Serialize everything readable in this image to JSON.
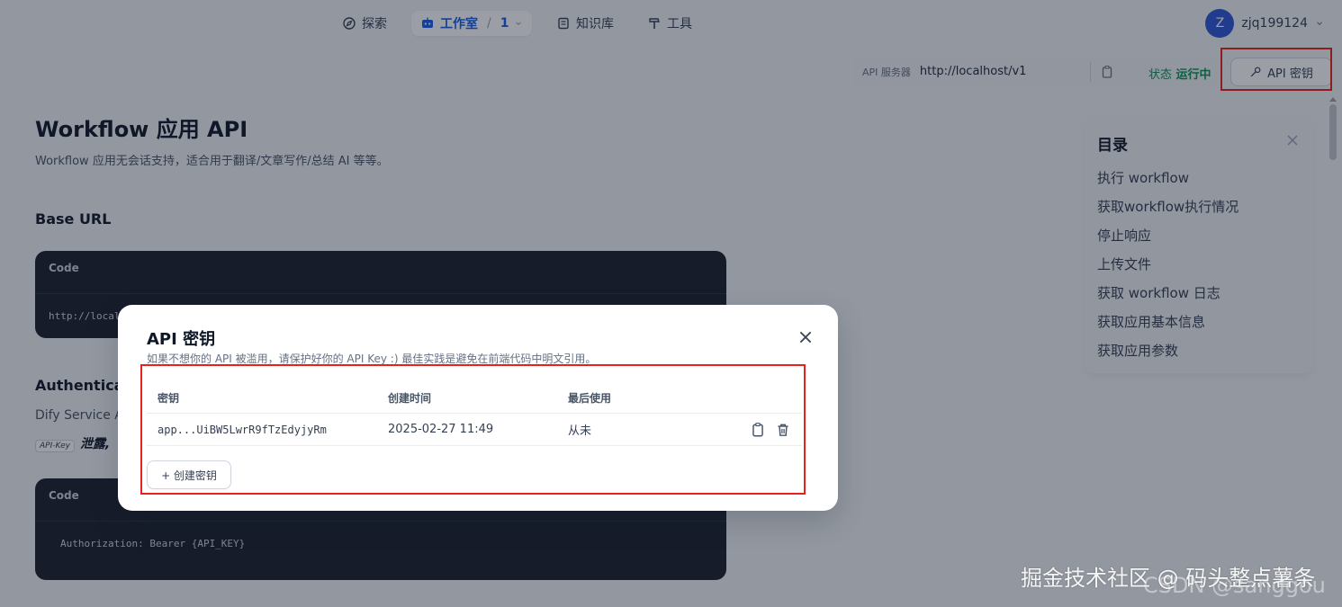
{
  "nav": {
    "explore": "探索",
    "studio": "工作室",
    "studio_sep": "/",
    "studio_count": "1",
    "knowledge": "知识库",
    "tools": "工具"
  },
  "user": {
    "initial": "Z",
    "name": "zjq199124"
  },
  "api_bar": {
    "server_label": "API 服务器",
    "server_url": "http://localhost/v1",
    "status_label": "状态",
    "status_value": "运行中",
    "api_key_button": "API 密钥"
  },
  "doc": {
    "title": "Workflow 应用 API",
    "description": "Workflow 应用无会话支持，适合用于翻译/文章写作/总结 AI 等等。",
    "base_url_heading": "Base URL",
    "code1_label": "Code",
    "code1_text": "http://local",
    "auth_heading": "Authenticat",
    "auth_text": "Dify Service A",
    "auth_tag": "API-Key",
    "auth_emphasis": "泄露,",
    "code2_label": "Code",
    "code2_text": "Authorization: Bearer {API_KEY}"
  },
  "toc": {
    "title": "目录",
    "items": [
      "执行 workflow",
      "获取workflow执行情况",
      "停止响应",
      "上传文件",
      "获取 workflow 日志",
      "获取应用基本信息",
      "获取应用参数"
    ]
  },
  "modal": {
    "title": "API 密钥",
    "description": "如果不想你的 API 被滥用，请保护好你的 API Key :) 最佳实践是避免在前端代码中明文引用。",
    "columns": {
      "key": "密钥",
      "created": "创建时间",
      "last_used": "最后使用"
    },
    "rows": [
      {
        "key": "app...UiBW5LwrR9fTzEdyjyRm",
        "created": "2025-02-27 11:49",
        "last_used": "从未"
      }
    ],
    "create_button": "+ 创建密钥"
  },
  "watermark": {
    "line1": "掘金技术社区 @ 码头整点薯条",
    "line2": "CSDN @sanggou"
  },
  "colors": {
    "accent": "#155eef",
    "status_green": "#079455",
    "highlight_red": "#e5221c",
    "code_bg": "#1a1f2c"
  }
}
